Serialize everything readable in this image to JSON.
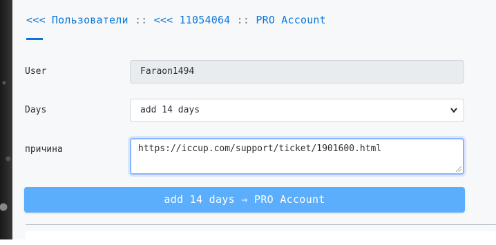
{
  "breadcrumb": {
    "users_link": "<<< Пользователи",
    "sep1": "::",
    "user_link": "<<< 11054064",
    "sep2": "::",
    "current": "PRO Account"
  },
  "form": {
    "user_label": "User",
    "user_value": "Faraon1494",
    "days_label": "Days",
    "days_selected": "add 14 days",
    "reason_label": "причина",
    "reason_value": "https://iccup.com/support/ticket/1901600.html",
    "submit_label": "add 14 days ⇒ PRO Account"
  },
  "icons": {
    "select_chevron": "chevron-down-icon"
  },
  "colors": {
    "link": "#0b76d8",
    "button": "#5aaefc",
    "focus_border": "#86b7fe"
  }
}
